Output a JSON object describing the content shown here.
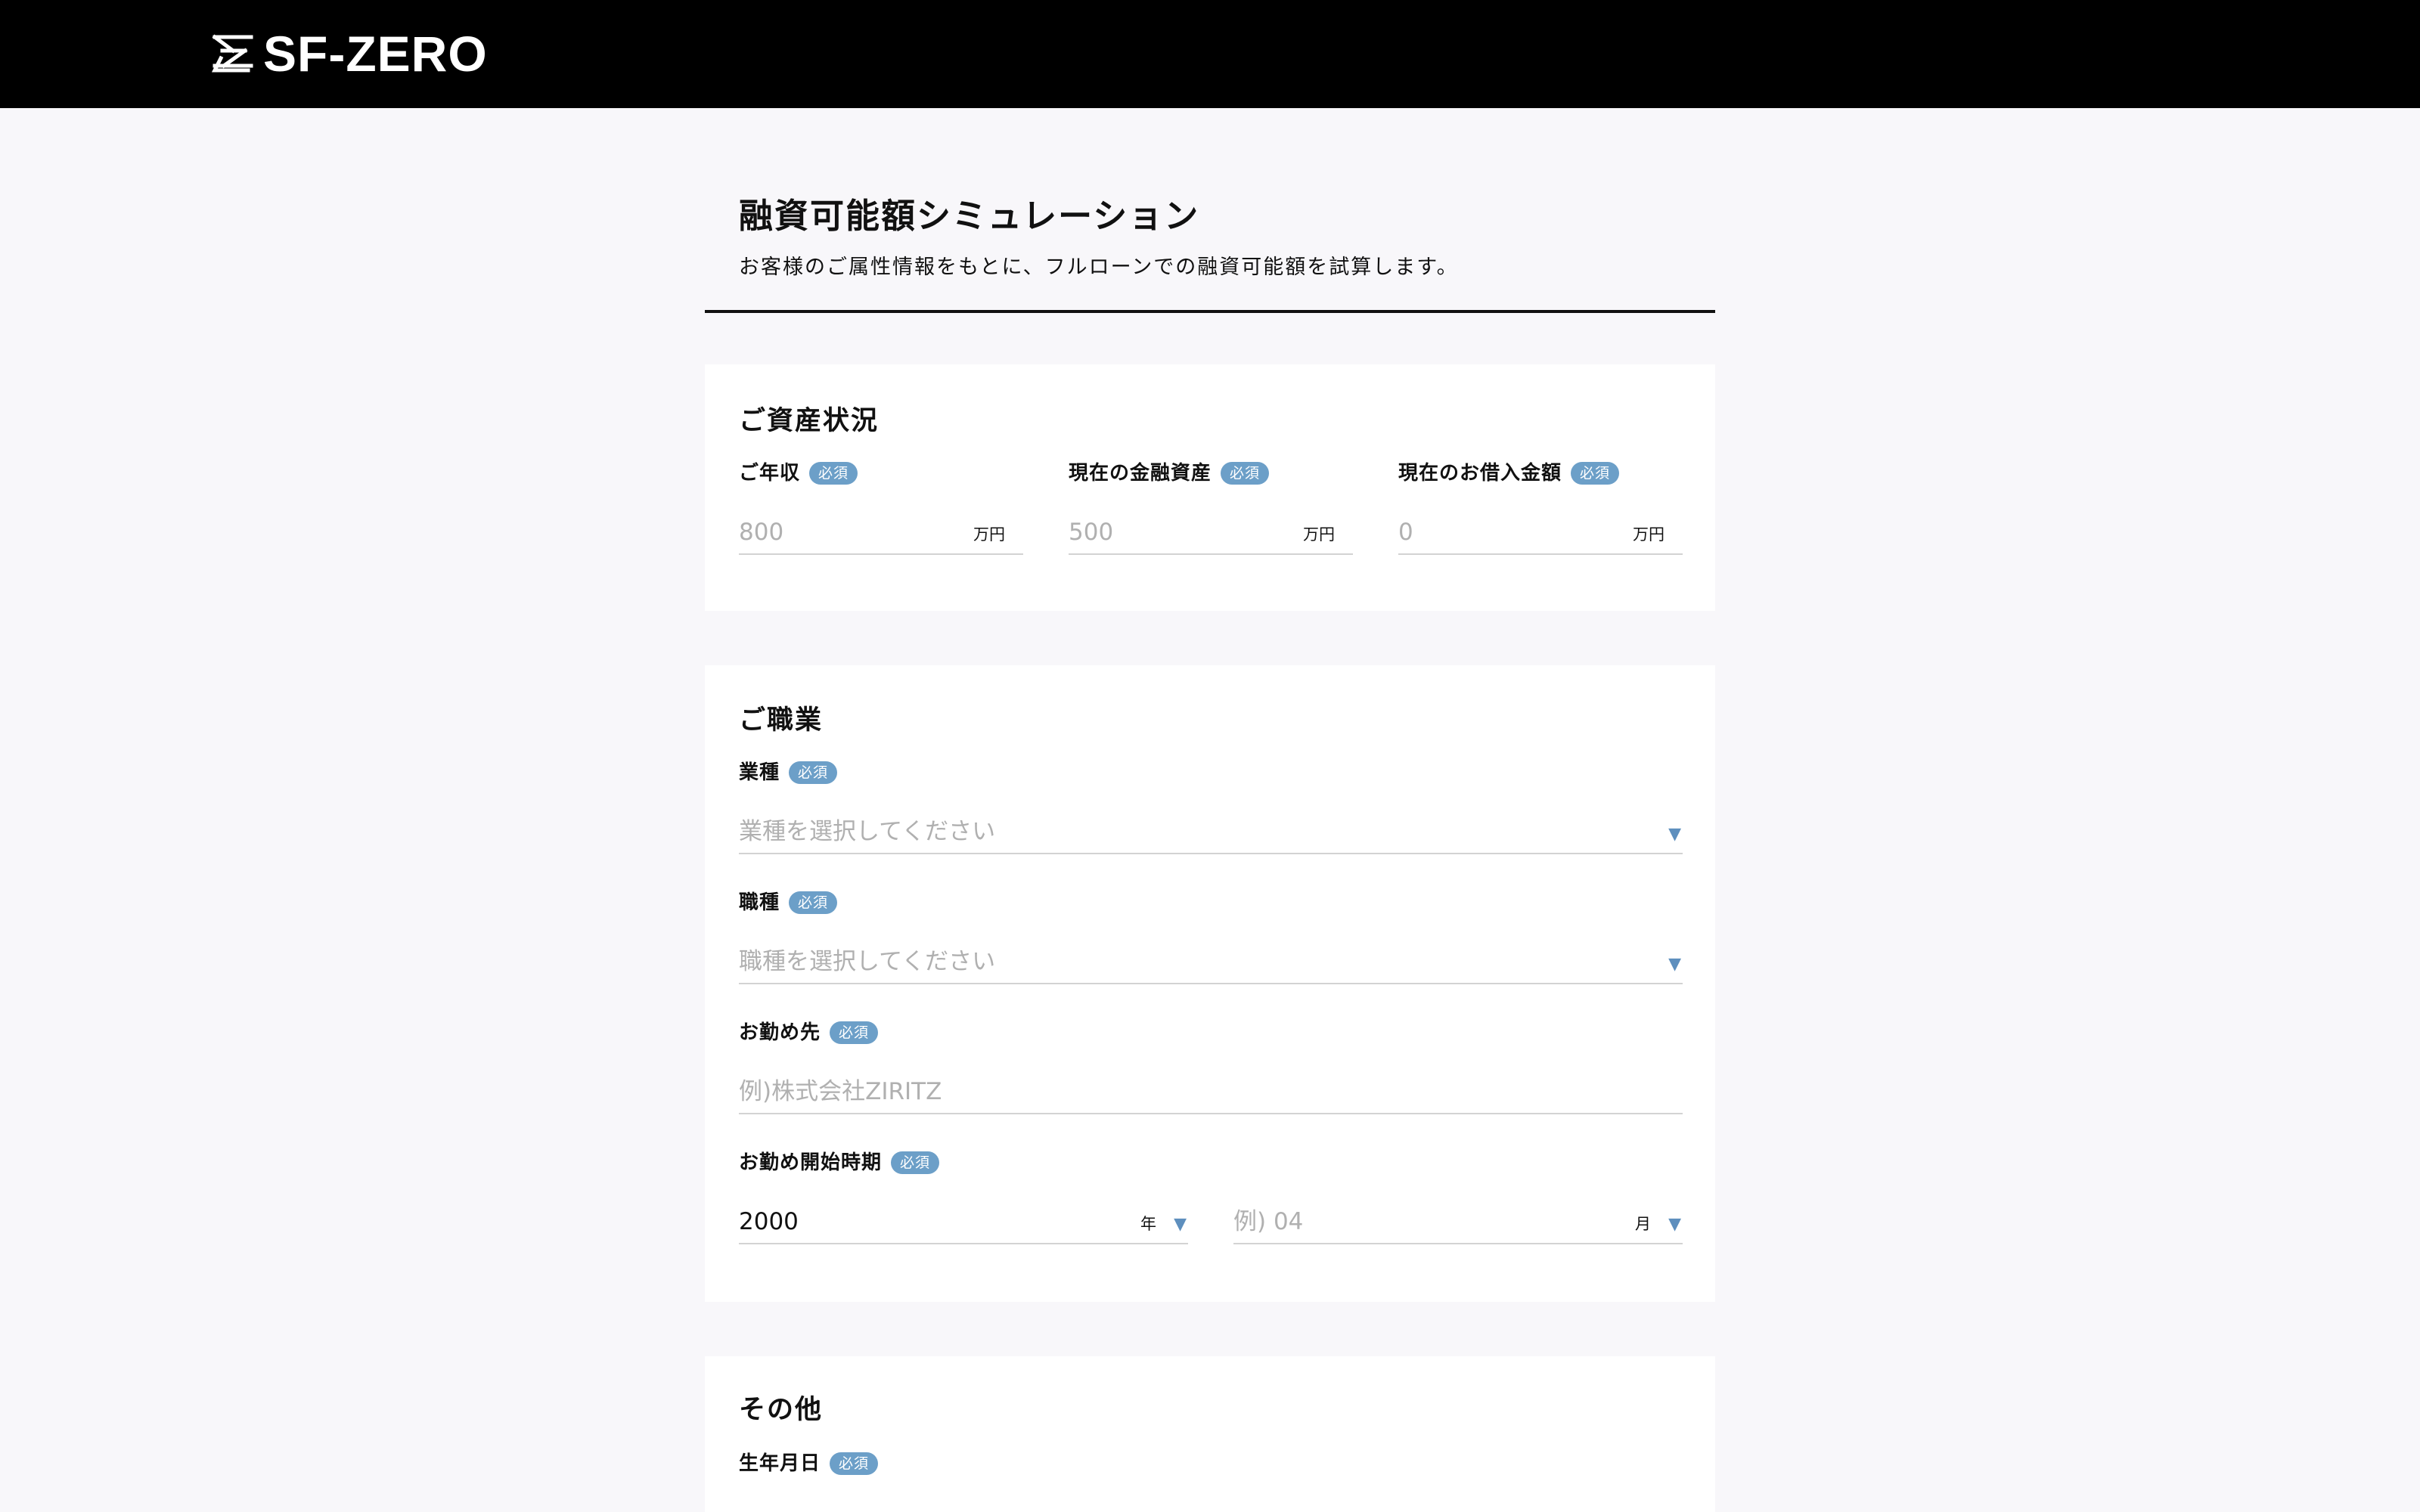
{
  "header": {
    "logo_text": "SF-ZERO"
  },
  "page": {
    "title": "融資可能額シミュレーション",
    "description": "お客様のご属性情報をもとに、フルローンでの融資可能額を試算します。"
  },
  "required_badge": "必須",
  "assets": {
    "title": "ご資産状況",
    "fields": [
      {
        "label": "ご年収",
        "placeholder": "800",
        "unit": "万円"
      },
      {
        "label": "現在の金融資産",
        "placeholder": "500",
        "unit": "万円"
      },
      {
        "label": "現在のお借入金額",
        "placeholder": "0",
        "unit": "万円"
      }
    ]
  },
  "occupation": {
    "title": "ご職業",
    "industry": {
      "label": "業種",
      "placeholder": "業種を選択してください"
    },
    "job_type": {
      "label": "職種",
      "placeholder": "職種を選択してください"
    },
    "employer": {
      "label": "お勤め先",
      "placeholder": "例)株式会社ZIRITZ"
    },
    "start": {
      "label": "お勤め開始時期",
      "year_value": "2000",
      "year_unit": "年",
      "month_placeholder": "例) 04",
      "month_unit": "月"
    }
  },
  "other": {
    "title": "その他",
    "birthdate": {
      "label": "生年月日"
    }
  },
  "icons": {
    "dropdown": "caret-down-icon",
    "logo": "sf-zero-logo-mark"
  },
  "colors": {
    "header_bg": "#000000",
    "badge": "#6c9fc8",
    "caret": "#5e8fbe",
    "page_bg": "#f8f7fa"
  }
}
